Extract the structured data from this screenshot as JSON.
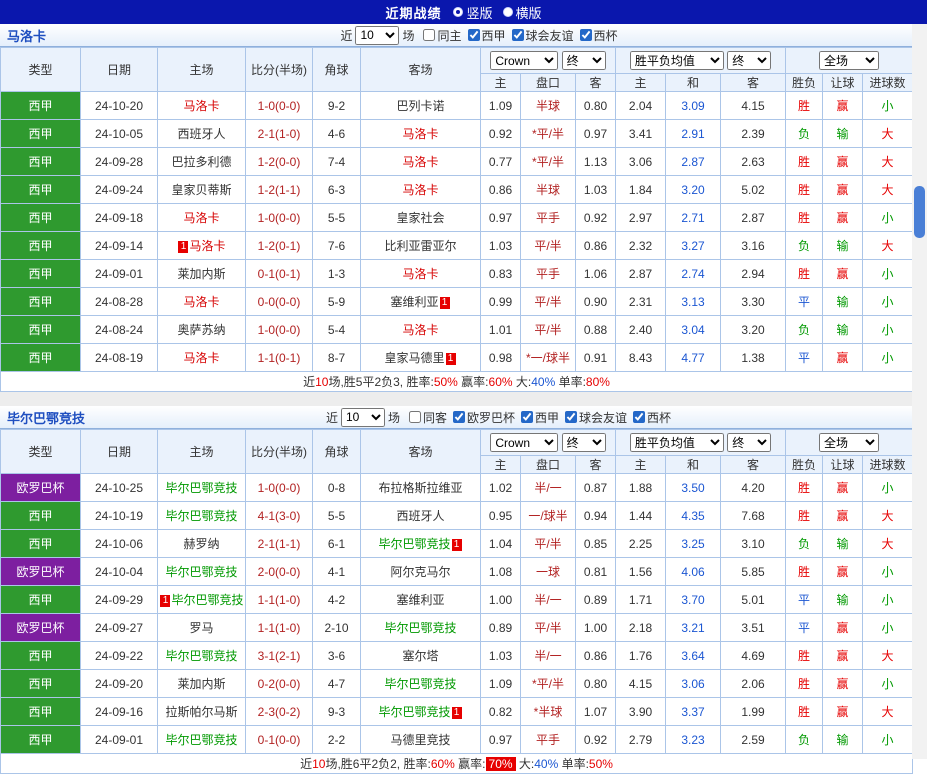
{
  "topbar": {
    "title": "近期战绩",
    "options": [
      {
        "label": "竖版",
        "selected": true
      },
      {
        "label": "横版",
        "selected": false
      }
    ]
  },
  "filters_prefix": "近",
  "filters_suffix": "场",
  "table_header": {
    "type": "类型",
    "date": "日期",
    "home": "主场",
    "score": "比分(半场)",
    "corners": "角球",
    "away": "客场",
    "bookmaker_select": "Crown",
    "final_select": "终",
    "avg_select": "胜平负均值",
    "final_select2": "终",
    "fulltime_select": "全场",
    "sub": [
      "主",
      "盘口",
      "客",
      "主",
      "和",
      "客",
      "胜负",
      "让球",
      "进球数"
    ]
  },
  "colors": {
    "topbar_blue": "#0a17ad",
    "league_green": "#2f9a2f",
    "league_purple": "#7d1fa0",
    "win_red": "#e60000",
    "lose_green": "#009900",
    "draw_blue": "#1b56d2",
    "team1_highlight": "#d60000",
    "team2_highlight": "#009900"
  },
  "sections": [
    {
      "team": "马洛卡",
      "team_color": "#d60000",
      "near_value": "10",
      "filters": [
        {
          "label": "同主",
          "checked": false
        },
        {
          "label": "西甲",
          "checked": true
        },
        {
          "label": "球会友谊",
          "checked": true
        },
        {
          "label": "西杯",
          "checked": true
        }
      ],
      "rows": [
        {
          "league": "西甲",
          "league_class": "green",
          "date": "24-10-20",
          "home": "马洛卡",
          "home_hl": true,
          "home_card": "",
          "score": "1-0(0-0)",
          "corners": "9-2",
          "away": "巴列卡诺",
          "away_hl": false,
          "away_card": "",
          "ah": [
            "1.09",
            "半球",
            "0.80"
          ],
          "eu": [
            "2.04",
            "3.09",
            "4.15"
          ],
          "res": [
            "胜",
            "赢",
            "小"
          ]
        },
        {
          "league": "西甲",
          "league_class": "green",
          "date": "24-10-05",
          "home": "西班牙人",
          "home_hl": false,
          "home_card": "",
          "score": "2-1(1-0)",
          "corners": "4-6",
          "away": "马洛卡",
          "away_hl": true,
          "away_card": "",
          "ah": [
            "0.92",
            "*平/半",
            "0.97"
          ],
          "eu": [
            "3.41",
            "2.91",
            "2.39"
          ],
          "res": [
            "负",
            "输",
            "大"
          ]
        },
        {
          "league": "西甲",
          "league_class": "green",
          "date": "24-09-28",
          "home": "巴拉多利德",
          "home_hl": false,
          "home_card": "",
          "score": "1-2(0-0)",
          "corners": "7-4",
          "away": "马洛卡",
          "away_hl": true,
          "away_card": "",
          "ah": [
            "0.77",
            "*平/半",
            "1.13"
          ],
          "eu": [
            "3.06",
            "2.87",
            "2.63"
          ],
          "res": [
            "胜",
            "赢",
            "大"
          ]
        },
        {
          "league": "西甲",
          "league_class": "green",
          "date": "24-09-24",
          "home": "皇家贝蒂斯",
          "home_hl": false,
          "home_card": "",
          "score": "1-2(1-1)",
          "corners": "6-3",
          "away": "马洛卡",
          "away_hl": true,
          "away_card": "",
          "ah": [
            "0.86",
            "半球",
            "1.03"
          ],
          "eu": [
            "1.84",
            "3.20",
            "5.02"
          ],
          "res": [
            "胜",
            "赢",
            "大"
          ]
        },
        {
          "league": "西甲",
          "league_class": "green",
          "date": "24-09-18",
          "home": "马洛卡",
          "home_hl": true,
          "home_card": "",
          "score": "1-0(0-0)",
          "corners": "5-5",
          "away": "皇家社会",
          "away_hl": false,
          "away_card": "",
          "ah": [
            "0.97",
            "平手",
            "0.92"
          ],
          "eu": [
            "2.97",
            "2.71",
            "2.87"
          ],
          "res": [
            "胜",
            "赢",
            "小"
          ]
        },
        {
          "league": "西甲",
          "league_class": "green",
          "date": "24-09-14",
          "home": "马洛卡",
          "home_hl": true,
          "home_card": "1",
          "score": "1-2(0-1)",
          "corners": "7-6",
          "away": "比利亚雷亚尔",
          "away_hl": false,
          "away_card": "",
          "ah": [
            "1.03",
            "平/半",
            "0.86"
          ],
          "eu": [
            "2.32",
            "3.27",
            "3.16"
          ],
          "res": [
            "负",
            "输",
            "大"
          ]
        },
        {
          "league": "西甲",
          "league_class": "green",
          "date": "24-09-01",
          "home": "莱加内斯",
          "home_hl": false,
          "home_card": "",
          "score": "0-1(0-1)",
          "corners": "1-3",
          "away": "马洛卡",
          "away_hl": true,
          "away_card": "",
          "ah": [
            "0.83",
            "平手",
            "1.06"
          ],
          "eu": [
            "2.87",
            "2.74",
            "2.94"
          ],
          "res": [
            "胜",
            "赢",
            "小"
          ]
        },
        {
          "league": "西甲",
          "league_class": "green",
          "date": "24-08-28",
          "home": "马洛卡",
          "home_hl": true,
          "home_card": "",
          "score": "0-0(0-0)",
          "corners": "5-9",
          "away": "塞维利亚",
          "away_hl": false,
          "away_card": "1",
          "ah": [
            "0.99",
            "平/半",
            "0.90"
          ],
          "eu": [
            "2.31",
            "3.13",
            "3.30"
          ],
          "res": [
            "平",
            "输",
            "小"
          ]
        },
        {
          "league": "西甲",
          "league_class": "green",
          "date": "24-08-24",
          "home": "奥萨苏纳",
          "home_hl": false,
          "home_card": "",
          "score": "1-0(0-0)",
          "corners": "5-4",
          "away": "马洛卡",
          "away_hl": true,
          "away_card": "",
          "ah": [
            "1.01",
            "平/半",
            "0.88"
          ],
          "eu": [
            "2.40",
            "3.04",
            "3.20"
          ],
          "res": [
            "负",
            "输",
            "小"
          ]
        },
        {
          "league": "西甲",
          "league_class": "green",
          "date": "24-08-19",
          "home": "马洛卡",
          "home_hl": true,
          "home_card": "",
          "score": "1-1(0-1)",
          "corners": "8-7",
          "away": "皇家马德里",
          "away_hl": false,
          "away_card": "1",
          "ah": [
            "0.98",
            "*一/球半",
            "0.91"
          ],
          "eu": [
            "8.43",
            "4.77",
            "1.38"
          ],
          "res": [
            "平",
            "赢",
            "小"
          ]
        }
      ],
      "summary": [
        {
          "t": "近"
        },
        {
          "t": "10",
          "c": "red"
        },
        {
          "t": "场,胜5平2负3, 胜率:"
        },
        {
          "t": "50%",
          "c": "red"
        },
        {
          "t": " 赢率:"
        },
        {
          "t": "60%",
          "c": "red"
        },
        {
          "t": " 大:"
        },
        {
          "t": "40%",
          "c": "blue"
        },
        {
          "t": " 单率:"
        },
        {
          "t": "80%",
          "c": "red"
        }
      ]
    },
    {
      "team": "毕尔巴鄂竞技",
      "team_color": "#009900",
      "near_value": "10",
      "filters": [
        {
          "label": "同客",
          "checked": false
        },
        {
          "label": "欧罗巴杯",
          "checked": true
        },
        {
          "label": "西甲",
          "checked": true
        },
        {
          "label": "球会友谊",
          "checked": true
        },
        {
          "label": "西杯",
          "checked": true
        }
      ],
      "rows": [
        {
          "league": "欧罗巴杯",
          "league_class": "purple",
          "date": "24-10-25",
          "home": "毕尔巴鄂竞技",
          "home_hl": true,
          "home_card": "",
          "score": "1-0(0-0)",
          "corners": "0-8",
          "away": "布拉格斯拉维亚",
          "away_hl": false,
          "away_card": "",
          "ah": [
            "1.02",
            "半/一",
            "0.87"
          ],
          "eu": [
            "1.88",
            "3.50",
            "4.20"
          ],
          "res": [
            "胜",
            "赢",
            "小"
          ]
        },
        {
          "league": "西甲",
          "league_class": "green",
          "date": "24-10-19",
          "home": "毕尔巴鄂竞技",
          "home_hl": true,
          "home_card": "",
          "score": "4-1(3-0)",
          "corners": "5-5",
          "away": "西班牙人",
          "away_hl": false,
          "away_card": "",
          "ah": [
            "0.95",
            "一/球半",
            "0.94"
          ],
          "eu": [
            "1.44",
            "4.35",
            "7.68"
          ],
          "res": [
            "胜",
            "赢",
            "大"
          ]
        },
        {
          "league": "西甲",
          "league_class": "green",
          "date": "24-10-06",
          "home": "赫罗纳",
          "home_hl": false,
          "home_card": "",
          "score": "2-1(1-1)",
          "corners": "6-1",
          "away": "毕尔巴鄂竞技",
          "away_hl": true,
          "away_card": "1",
          "ah": [
            "1.04",
            "平/半",
            "0.85"
          ],
          "eu": [
            "2.25",
            "3.25",
            "3.10"
          ],
          "res": [
            "负",
            "输",
            "大"
          ]
        },
        {
          "league": "欧罗巴杯",
          "league_class": "purple",
          "date": "24-10-04",
          "home": "毕尔巴鄂竞技",
          "home_hl": true,
          "home_card": "",
          "score": "2-0(0-0)",
          "corners": "4-1",
          "away": "阿尔克马尔",
          "away_hl": false,
          "away_card": "",
          "ah": [
            "1.08",
            "一球",
            "0.81"
          ],
          "eu": [
            "1.56",
            "4.06",
            "5.85"
          ],
          "res": [
            "胜",
            "赢",
            "小"
          ]
        },
        {
          "league": "西甲",
          "league_class": "green",
          "date": "24-09-29",
          "home": "毕尔巴鄂竞技",
          "home_hl": true,
          "home_card": "1",
          "score": "1-1(1-0)",
          "corners": "4-2",
          "away": "塞维利亚",
          "away_hl": false,
          "away_card": "",
          "ah": [
            "1.00",
            "半/一",
            "0.89"
          ],
          "eu": [
            "1.71",
            "3.70",
            "5.01"
          ],
          "res": [
            "平",
            "输",
            "小"
          ]
        },
        {
          "league": "欧罗巴杯",
          "league_class": "purple",
          "date": "24-09-27",
          "home": "罗马",
          "home_hl": false,
          "home_card": "",
          "score": "1-1(1-0)",
          "corners": "2-10",
          "away": "毕尔巴鄂竞技",
          "away_hl": true,
          "away_card": "",
          "ah": [
            "0.89",
            "平/半",
            "1.00"
          ],
          "eu": [
            "2.18",
            "3.21",
            "3.51"
          ],
          "res": [
            "平",
            "赢",
            "小"
          ]
        },
        {
          "league": "西甲",
          "league_class": "green",
          "date": "24-09-22",
          "home": "毕尔巴鄂竞技",
          "home_hl": true,
          "home_card": "",
          "score": "3-1(2-1)",
          "corners": "3-6",
          "away": "塞尔塔",
          "away_hl": false,
          "away_card": "",
          "ah": [
            "1.03",
            "半/一",
            "0.86"
          ],
          "eu": [
            "1.76",
            "3.64",
            "4.69"
          ],
          "res": [
            "胜",
            "赢",
            "大"
          ]
        },
        {
          "league": "西甲",
          "league_class": "green",
          "date": "24-09-20",
          "home": "莱加内斯",
          "home_hl": false,
          "home_card": "",
          "score": "0-2(0-0)",
          "corners": "4-7",
          "away": "毕尔巴鄂竞技",
          "away_hl": true,
          "away_card": "",
          "ah": [
            "1.09",
            "*平/半",
            "0.80"
          ],
          "eu": [
            "4.15",
            "3.06",
            "2.06"
          ],
          "res": [
            "胜",
            "赢",
            "小"
          ]
        },
        {
          "league": "西甲",
          "league_class": "green",
          "date": "24-09-16",
          "home": "拉斯帕尔马斯",
          "home_hl": false,
          "home_card": "",
          "score": "2-3(0-2)",
          "corners": "9-3",
          "away": "毕尔巴鄂竞技",
          "away_hl": true,
          "away_card": "1",
          "ah": [
            "0.82",
            "*半球",
            "1.07"
          ],
          "eu": [
            "3.90",
            "3.37",
            "1.99"
          ],
          "res": [
            "胜",
            "赢",
            "大"
          ]
        },
        {
          "league": "西甲",
          "league_class": "green",
          "date": "24-09-01",
          "home": "毕尔巴鄂竞技",
          "home_hl": true,
          "home_card": "",
          "score": "0-1(0-0)",
          "corners": "2-2",
          "away": "马德里竞技",
          "away_hl": false,
          "away_card": "",
          "ah": [
            "0.97",
            "平手",
            "0.92"
          ],
          "eu": [
            "2.79",
            "3.23",
            "2.59"
          ],
          "res": [
            "负",
            "输",
            "小"
          ]
        }
      ],
      "summary": [
        {
          "t": "近"
        },
        {
          "t": "10",
          "c": "red"
        },
        {
          "t": "场,胜6平2负2, 胜率:"
        },
        {
          "t": "60%",
          "c": "red"
        },
        {
          "t": " 赢率:"
        },
        {
          "t": "70%",
          "c": "redbox"
        },
        {
          "t": " 大:"
        },
        {
          "t": "40%",
          "c": "blue"
        },
        {
          "t": " 单率:"
        },
        {
          "t": "50%",
          "c": "red"
        }
      ]
    }
  ]
}
